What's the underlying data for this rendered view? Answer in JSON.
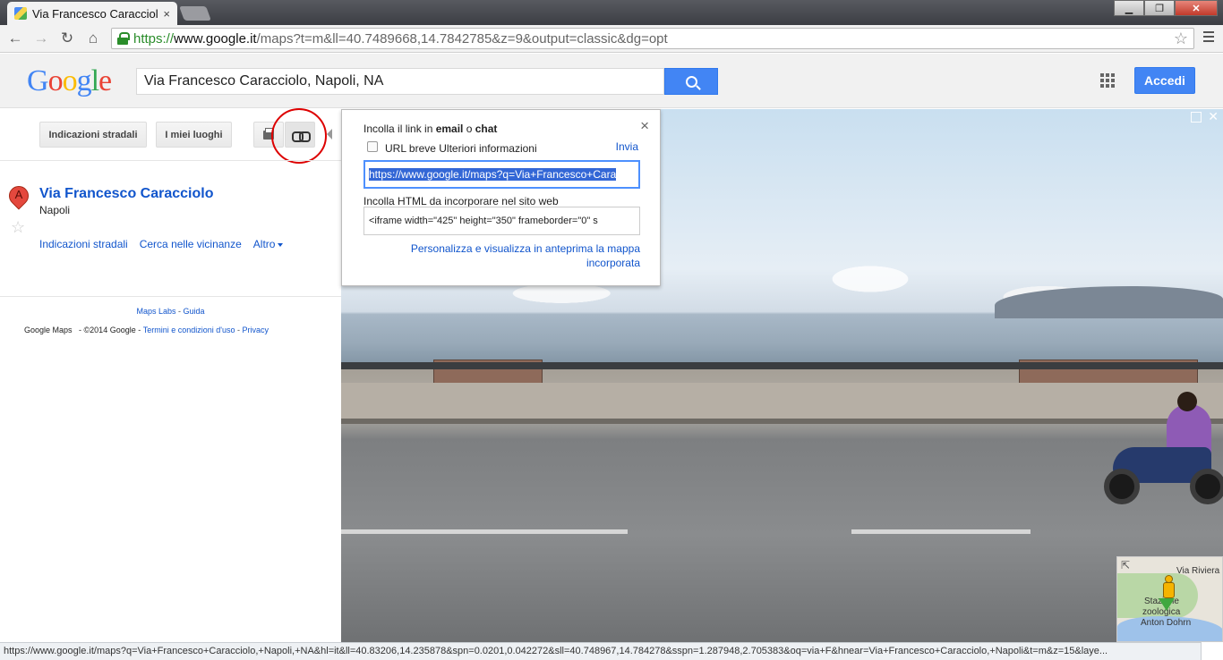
{
  "browser": {
    "tab_title": "Via Francesco Caracciolo,",
    "tab_close": "×",
    "url_scheme": "https://",
    "url_host": "www.google.it",
    "url_path": "/maps?t=m&ll=40.7489668,14.7842785&z=9&output=classic&dg=opt",
    "nav": {
      "back": "←",
      "forward": "→",
      "reload": "↻",
      "home": "⌂"
    },
    "star": "☆",
    "window": {
      "minimize": "▁",
      "maximize": "❐",
      "close": "✕"
    }
  },
  "header": {
    "logo": [
      "G",
      "o",
      "o",
      "g",
      "l",
      "e"
    ],
    "logo_colors": [
      "#4285f4",
      "#ea4335",
      "#fbbc05",
      "#4285f4",
      "#34a853",
      "#ea4335"
    ],
    "search_value": "Via Francesco Caracciolo, Napoli, NA",
    "signin_label": "Accedi"
  },
  "left_panel": {
    "directions_btn": "Indicazioni stradali",
    "my_places_btn": "I miei luoghi",
    "marker_letter": "A",
    "place_title": "Via Francesco Caracciolo",
    "place_city": "Napoli",
    "links": {
      "directions": "Indicazioni stradali",
      "nearby": "Cerca nelle vicinanze",
      "more": "Altro"
    },
    "footer": {
      "labs": "Maps Labs",
      "sep": " - ",
      "help": "Guida",
      "maps": "Google Maps",
      "copyright": "- ©2014 Google -",
      "terms": "Termini e condizioni d'uso",
      "privacy": "Privacy"
    }
  },
  "share_popup": {
    "title_pre": "Incolla il link in ",
    "title_email": "email",
    "title_mid": " o ",
    "title_chat": "chat",
    "close": "×",
    "short_url_label": "URL breve",
    "more_info": "Ulteriori informazioni",
    "send": "Invia",
    "link_value": "https://www.google.it/maps?q=Via+Francesco+Cara",
    "embed_label": "Incolla HTML da incorporare nel sito web",
    "embed_value": "<iframe width=\"425\" height=\"350\" frameborder=\"0\" s",
    "customize_link": "Personalizza e visualizza in anteprima la mappa incorporata"
  },
  "street_view": {
    "minimap_labels": {
      "road": "Via Riviera",
      "zoo1": "Stazione",
      "zoo2": "zoologica",
      "name": "Anton Dohrn"
    },
    "close": "✕"
  },
  "status_bar": {
    "text": "https://www.google.it/maps?q=Via+Francesco+Caracciolo,+Napoli,+NA&hl=it&ll=40.83206,14.235878&spn=0.0201,0.042272&sll=40.748967,14.784278&sspn=1.287948,2.705383&oq=via+F&hnear=Via+Francesco+Caracciolo,+Napoli&t=m&z=15&laye..."
  }
}
